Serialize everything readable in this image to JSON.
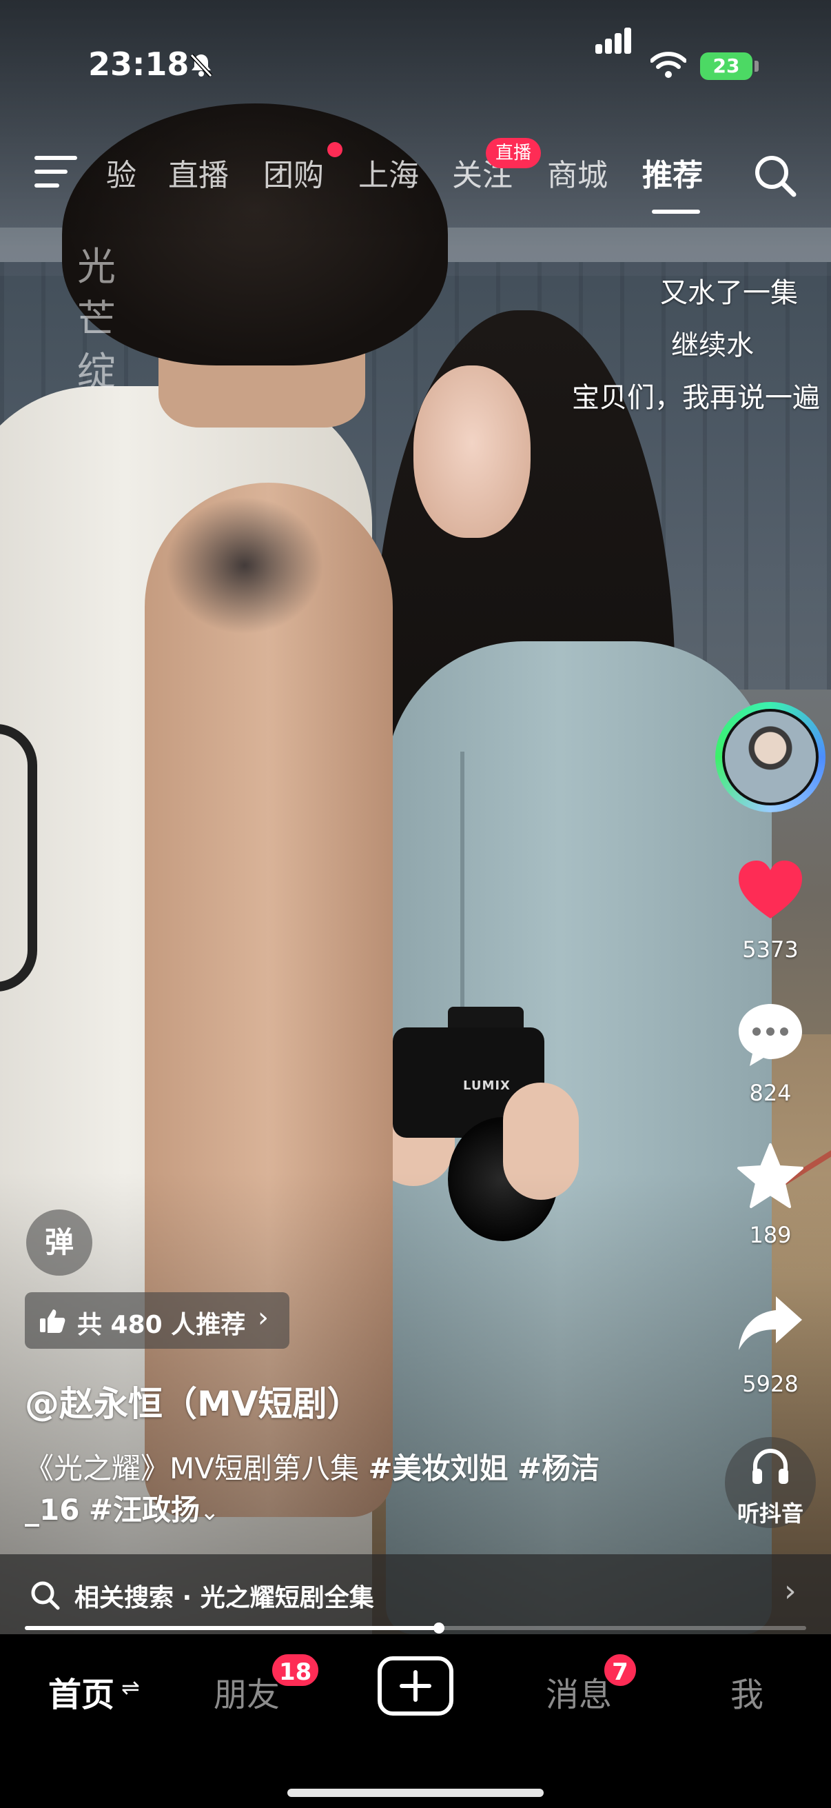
{
  "status_bar": {
    "time": "23:18",
    "battery": "23"
  },
  "top_nav": {
    "tabs": [
      "验",
      "直播",
      "团购",
      "上海",
      "关注",
      "商城",
      "推荐"
    ],
    "active_tab": "推荐",
    "live_badge": "直播"
  },
  "watermark": {
    "text": "光芒绽"
  },
  "danmaku": [
    "又水了一集",
    "继续水",
    "宝贝们，我再说一遍"
  ],
  "right_rail": {
    "likes": "5373",
    "comments": "824",
    "favorites": "189",
    "shares": "5928",
    "listen_label": "听抖音"
  },
  "video_info": {
    "danmu_toggle": "弹",
    "recommend": "共 480 人推荐",
    "author": "@赵永恒（MV短剧）",
    "description_prefix": "《光之耀》MV短剧第八集 ",
    "tags": [
      "#美妆刘姐",
      "#杨洁_16",
      "#汪政扬"
    ],
    "progress": 0.53
  },
  "related_search": {
    "label": "相关搜索 · 光之耀短剧全集"
  },
  "tab_bar": {
    "home": "首页",
    "friends": "朋友",
    "friends_badge": "18",
    "messages": "消息",
    "messages_badge": "7",
    "me": "我"
  },
  "colors": {
    "accent": "#fe2c55",
    "like_red": "#fe2c55",
    "battery_green": "#4cd964"
  }
}
